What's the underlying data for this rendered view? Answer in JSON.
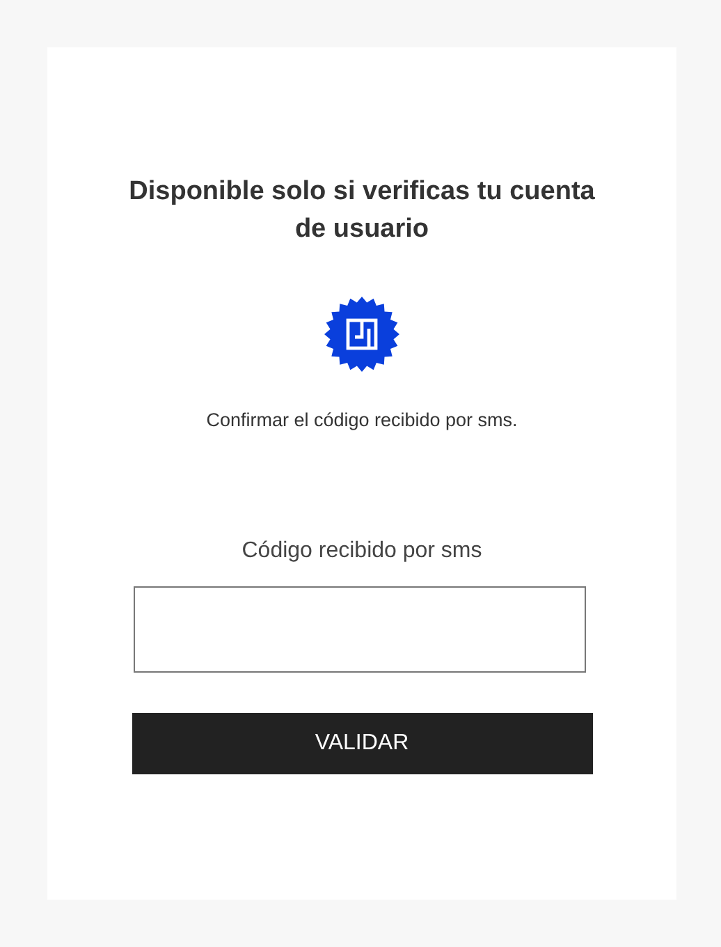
{
  "title": "Disponible solo si verificas tu cuenta de usuario",
  "instruction": "Confirmar el código recibido por sms.",
  "code_field": {
    "label": "Código recibido por sms"
  },
  "button": {
    "label": "VALIDAR"
  }
}
